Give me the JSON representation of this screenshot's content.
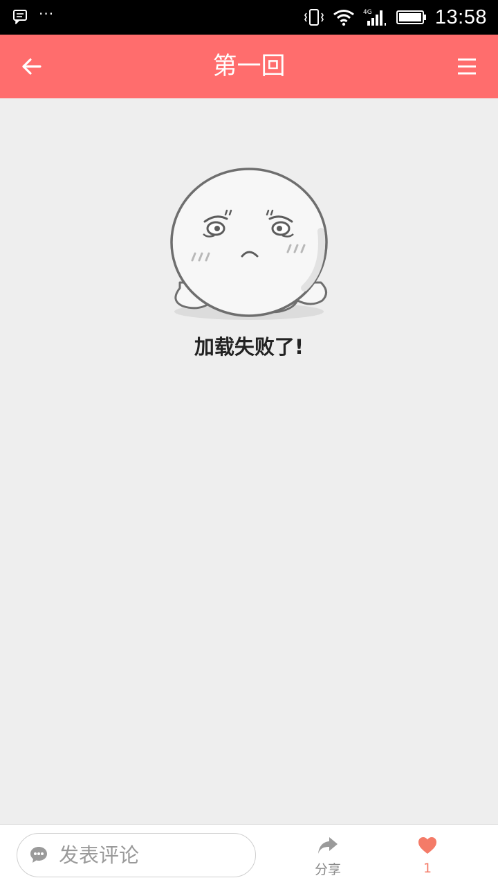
{
  "status_bar": {
    "time": "13:58",
    "network": "4G"
  },
  "header": {
    "title": "第一回",
    "back_icon": "arrow-left-icon",
    "menu_icon": "hamburger-menu-icon"
  },
  "main": {
    "error_message": "加载失败了!",
    "illustration": "sad-octopus-icon"
  },
  "bottom_bar": {
    "comment_placeholder": "发表评论",
    "share_label": "分享",
    "like_count": "1"
  },
  "colors": {
    "accent": "#ff6d6d",
    "background": "#eeeeee",
    "like": "#f47b68"
  }
}
